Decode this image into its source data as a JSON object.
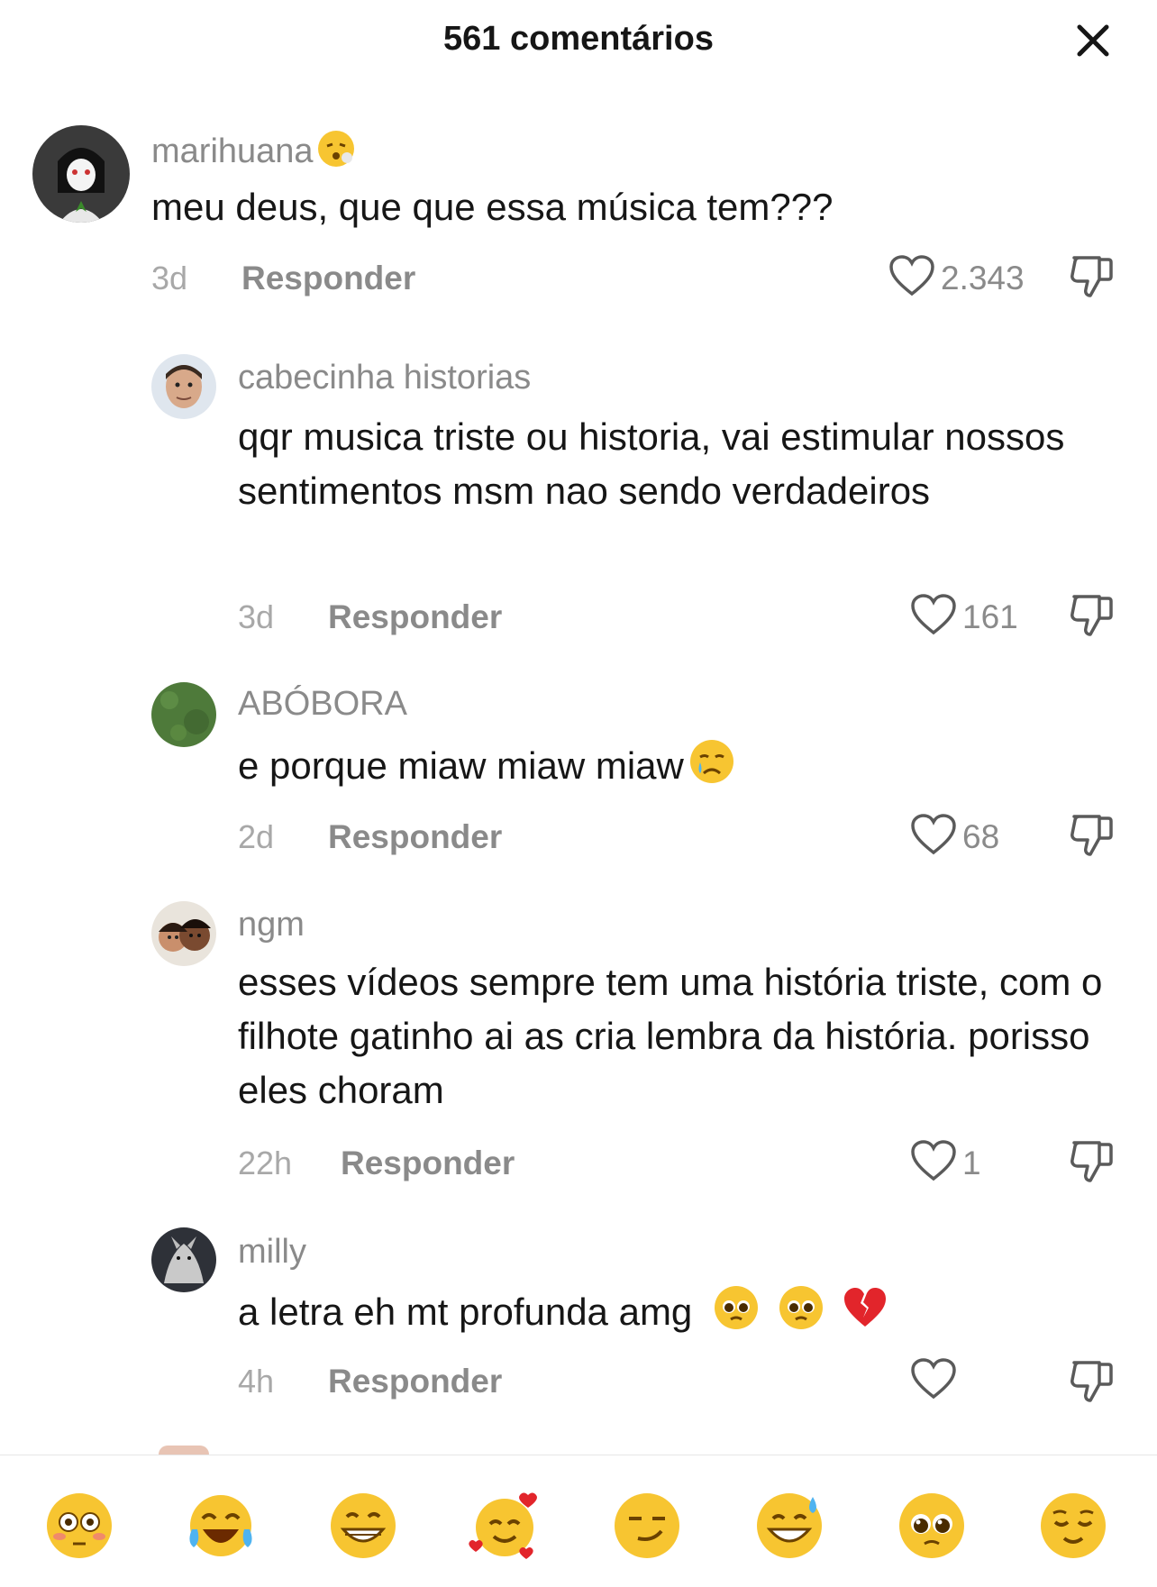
{
  "header": {
    "title": "561 comentários"
  },
  "comments": [
    {
      "username": "marihuana",
      "text": "meu deus, que que essa música tem???",
      "time": "3d",
      "reply": "Responder",
      "likes": "2.343"
    },
    {
      "username": "cabecinha historias",
      "text": "qqr musica triste ou historia, vai estimular nossos sentimentos msm nao sendo verdadeiros",
      "time": "3d",
      "reply": "Responder",
      "likes": "161"
    },
    {
      "username": "ABÓBORA",
      "text": "e porque miaw miaw miaw",
      "time": "2d",
      "reply": "Responder",
      "likes": "68"
    },
    {
      "username": "ngm",
      "text": "esses vídeos sempre tem uma história triste, com o filhote gatinho ai as cria lembra da história. porisso eles choram",
      "time": "22h",
      "reply": "Responder",
      "likes": "1"
    },
    {
      "username": "milly",
      "text": "a letra eh mt profunda amg",
      "time": "4h",
      "reply": "Responder",
      "likes": ""
    }
  ],
  "emoji_bar": [
    "flushed-face",
    "tears-of-joy",
    "grinning-face",
    "smiling-face-with-hearts",
    "smirking-face",
    "grinning-sweat",
    "pleading-face",
    "relieved-face"
  ],
  "colors": {
    "text": "#161616",
    "muted": "#8a8a8a",
    "time": "#a8a8a8"
  }
}
